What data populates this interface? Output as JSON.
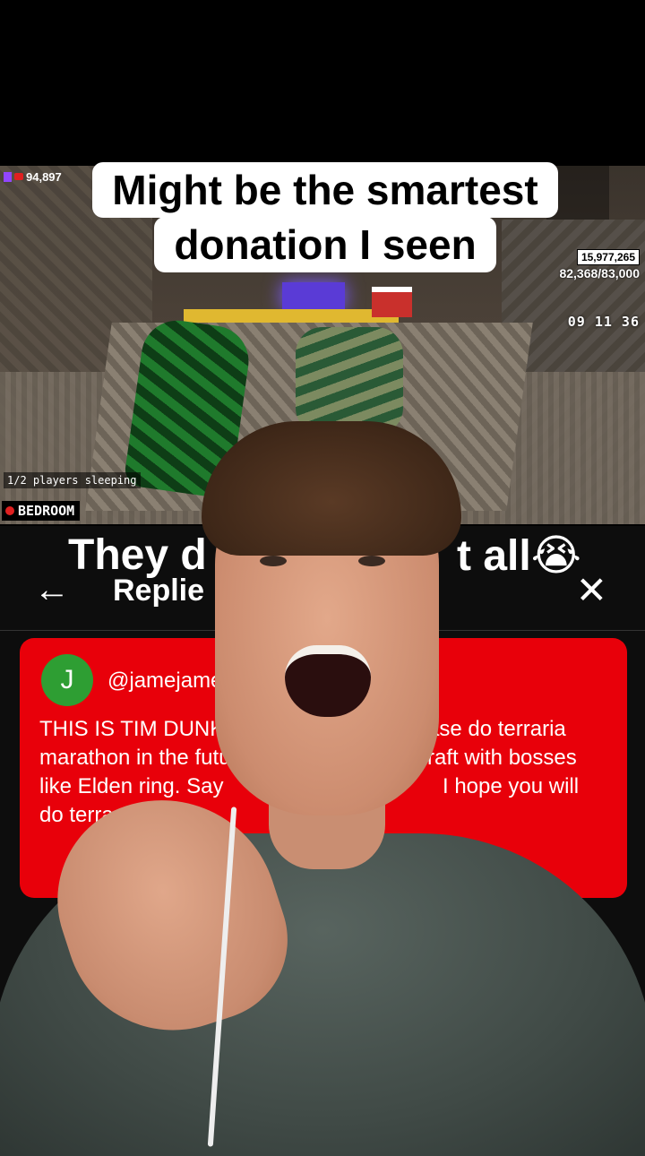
{
  "caption": {
    "line1": "Might be the smartest",
    "line2": "donation I seen"
  },
  "stream": {
    "viewer_count": "94,897",
    "stat_top": "15,977,265",
    "stat_sub": "82,368/83,000",
    "timer": "09 11 36",
    "sleeping_status": "1/2 players sleeping",
    "location": "BEDROOM",
    "icons": [
      "twitch-icon",
      "live-icon",
      "rec-dot-icon"
    ]
  },
  "reply_screen": {
    "heading_partial": "They d",
    "heading_end": "t all😭",
    "title_partial": "Replie",
    "back_icon": "←",
    "close_icon": "✕",
    "comment": {
      "avatar_letter": "J",
      "handle_partial": "@jamejame",
      "line1_start": "THIS IS TIM DUNK.",
      "line1_end": "ase do terraria",
      "line2_start": "marathon in the futu",
      "line2_end": "raft with bosses",
      "line3_start": "like Elden ring. Say",
      "line3_end": "I hope you will",
      "line4_start": "do terra"
    },
    "card_color": "#e8000a",
    "avatar_color": "#2e9e33"
  }
}
